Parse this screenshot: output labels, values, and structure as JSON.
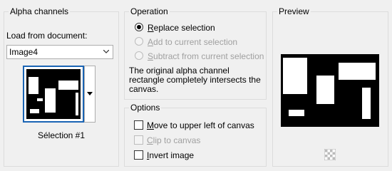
{
  "alpha": {
    "title": "Alpha channels",
    "load_label": "Load from document:",
    "document_value": "Image4",
    "selection_name": "Sélection #1"
  },
  "operation": {
    "title": "Operation",
    "replace_label": "Replace selection",
    "add_label": "Add to current selection",
    "subtract_label": "Subtract from current selection",
    "info_text": "The original alpha channel rectangle completely intersects the canvas.",
    "selected": "replace"
  },
  "options": {
    "title": "Options",
    "move_label": "Move to upper left of canvas",
    "clip_label": "Clip to canvas",
    "invert_label": "Invert image",
    "move_checked": false,
    "clip_checked": false,
    "invert_checked": false
  },
  "preview": {
    "title": "Preview"
  },
  "colors": {
    "thumb_border": "#1a64b4",
    "disabled_text": "#a0a0a0"
  }
}
